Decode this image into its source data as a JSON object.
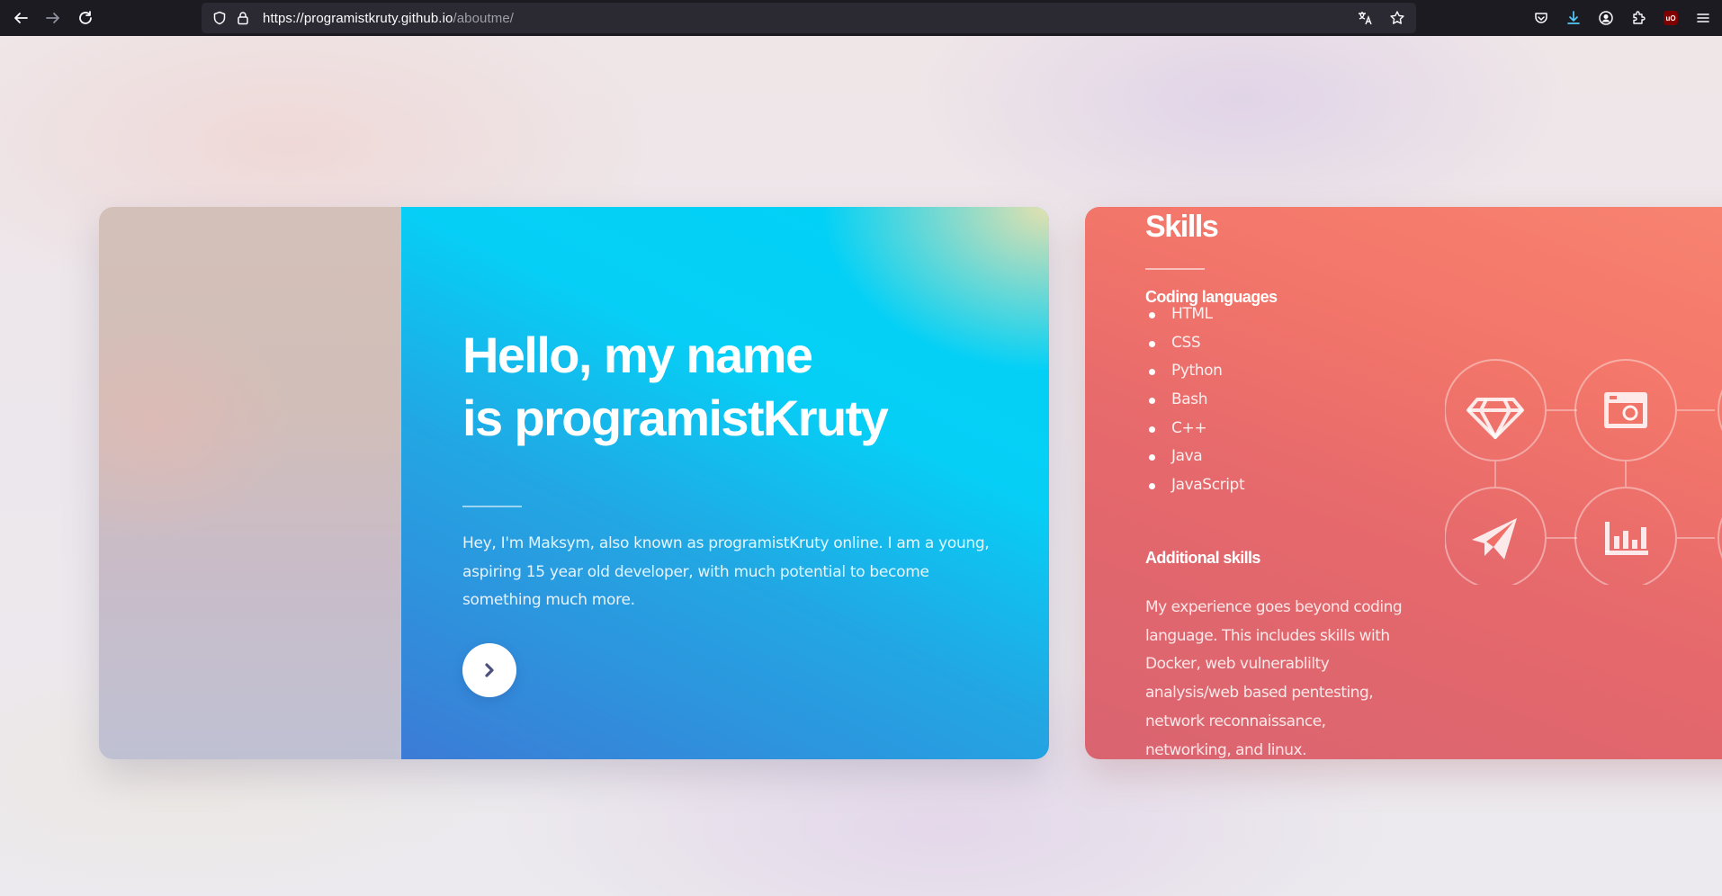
{
  "browser": {
    "url_host": "https://programistkruty.github.io",
    "url_path": "/aboutme/",
    "icons": {
      "back": "back-arrow-icon",
      "forward": "forward-arrow-icon",
      "reload": "reload-icon",
      "shield": "tracking-protection-shield-icon",
      "lock": "lock-icon",
      "translate": "translate-icon",
      "bookmark": "star-icon",
      "pocket": "pocket-icon",
      "downloads": "download-icon",
      "account": "account-icon",
      "extensions": "extensions-puzzle-icon",
      "ublock": "ublock-origin-icon",
      "menu": "hamburger-menu-icon"
    },
    "ublock_badge": "uO"
  },
  "intro_card": {
    "heading_line1": "Hello, my name",
    "heading_line2": "is programistKruty",
    "bio": "Hey, I'm Maksym, also known as programistKruty online. I am a young, aspiring 15 year old developer, with much potential to become something much more.",
    "next_icon": "chevron-right-icon",
    "accent_colors": [
      "#00d2f7",
      "#3c7bd6",
      "#f0e1aa"
    ]
  },
  "skills_card": {
    "title": "Skills",
    "coding_heading": "Coding languages",
    "languages": [
      "HTML",
      "CSS",
      "Python",
      "Bash",
      "C++",
      "Java",
      "JavaScript"
    ],
    "additional_heading": "Additional skills",
    "additional_text": "My experience goes beyond coding language. This includes skills with Docker, web vulnerablilty analysis/web based pentesting, network reconnaissance, networking, and linux.",
    "network_icons": [
      "diamond-icon",
      "browser-window-icon",
      "paper-plane-icon",
      "bar-chart-icon"
    ],
    "accent_colors": [
      "#d96470",
      "#f88471"
    ]
  }
}
